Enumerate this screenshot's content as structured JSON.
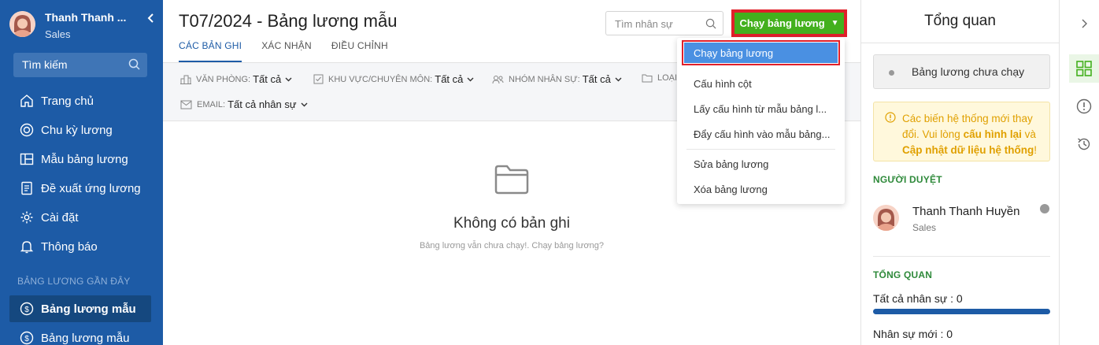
{
  "sidebar": {
    "user_name": "Thanh Thanh ...",
    "user_role": "Sales",
    "search_label": "Tìm kiếm",
    "items": [
      {
        "label": "Trang chủ"
      },
      {
        "label": "Chu kỳ lương"
      },
      {
        "label": "Mẫu bảng lương"
      },
      {
        "label": "Đề xuất ứng lương"
      },
      {
        "label": "Cài đặt"
      },
      {
        "label": "Thông báo"
      }
    ],
    "recent_section": "BẢNG LƯƠNG GẦN ĐÂY",
    "recent": [
      {
        "label": "Bảng lương mẫu"
      },
      {
        "label": "Bảng lương mẫu"
      }
    ]
  },
  "header": {
    "title": "T07/2024 - Bảng lương mẫu",
    "tabs": [
      "CÁC BẢN GHI",
      "XÁC NHẬN",
      "ĐIỀU CHỈNH"
    ],
    "search_placeholder": "Tìm nhân sự",
    "run_button": "Chạy bảng lương"
  },
  "filters": [
    {
      "label": "VĂN PHÒNG:",
      "value": "Tất cả"
    },
    {
      "label": "KHU VỰC/CHUYÊN MÔN:",
      "value": "Tất cả"
    },
    {
      "label": "NHÓM NHÂN SỰ:",
      "value": "Tất cả"
    },
    {
      "label": "LOẠI",
      "value": ""
    },
    {
      "label": "EMAIL:",
      "value": "Tất cả nhân sự"
    }
  ],
  "empty": {
    "title": "Không có bản ghi",
    "subtitle": "Bảng lương vẫn chưa chạy!. Chạy bảng lương?"
  },
  "dropdown": {
    "items": [
      "Chạy bảng lương",
      "Cấu hình cột",
      "Lấy cấu hình từ mẫu bảng l...",
      "Đẩy cấu hình vào mẫu bảng...",
      "Sửa bảng lương",
      "Xóa bảng lương"
    ]
  },
  "overview": {
    "title": "Tổng quan",
    "status": "Bảng lương chưa chạy",
    "warning_part1": "Các biến hệ thống mới thay đổi. Vui lòng ",
    "warning_link1": "cấu hình lại",
    "warning_part2": " và ",
    "warning_link2": "Cập nhật dữ liệu hệ thống",
    "warning_part3": "!",
    "approver_section": "NGƯỜI DUYỆT",
    "approver_name": "Thanh Thanh Huyền",
    "approver_role": "Sales",
    "summary_section": "TỔNG QUAN",
    "stats": [
      {
        "label": "Tất cả nhân sự : 0",
        "fill": 1.0
      },
      {
        "label": "Nhân sự mới : 0",
        "fill": 0.0
      }
    ]
  },
  "colors": {
    "sidebar": "#1d5ba6",
    "accent_green": "#43b01d",
    "highlight_red": "#e0202a",
    "selected_blue": "#4a90e2",
    "warning": "#e0a000"
  }
}
